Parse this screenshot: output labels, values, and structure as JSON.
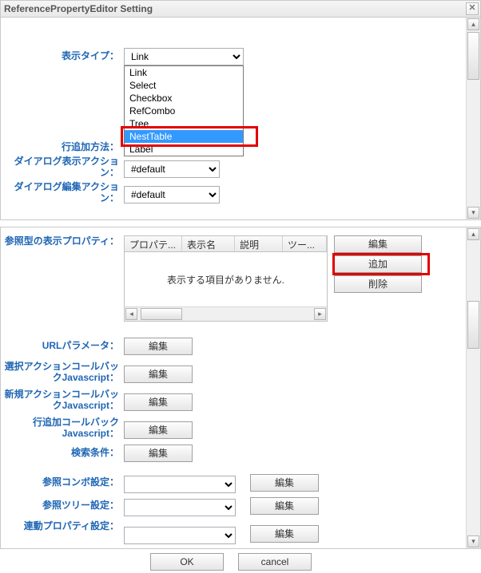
{
  "titlebar": {
    "title": "ReferencePropertyEditor Setting",
    "close": "✕"
  },
  "pane1": {
    "labels": {
      "display_type": "表示タイプ：",
      "add_method": "行追加方法：",
      "dialog_show": "ダイアログ表示アクション：",
      "dialog_edit": "ダイアログ編集アクション："
    },
    "display_type_value": "Link",
    "dropdown": {
      "o1": "Link",
      "o2": "Select",
      "o3": "Checkbox",
      "o4": "RefCombo",
      "o5": "Tree",
      "o6": "NestTable",
      "o7": "Label"
    },
    "dialog_show_value": "#default",
    "dialog_edit_value": "#default"
  },
  "pane2": {
    "labels": {
      "ref_prop": "参照型の表示プロパティ：",
      "url_param": "URLパラメータ：",
      "select_cb": "選択アクションコールバックJavascript：",
      "new_cb": "新規アクションコールバックJavascript：",
      "addrow_cb": "行追加コールバックJavascript：",
      "search_cond": "検索条件：",
      "ref_combo": "参照コンボ設定：",
      "ref_tree": "参照ツリー設定：",
      "linked_prop": "連動プロパティ設定："
    },
    "table": {
      "h1": "プロパテ...",
      "h2": "表示名",
      "h3": "説明",
      "h4": "ツー...",
      "empty": "表示する項目がありません."
    },
    "buttons": {
      "edit": "編集",
      "add": "追加",
      "delete": "削除"
    },
    "btn_edit": "編集"
  },
  "footer": {
    "ok": "OK",
    "cancel": "cancel"
  }
}
